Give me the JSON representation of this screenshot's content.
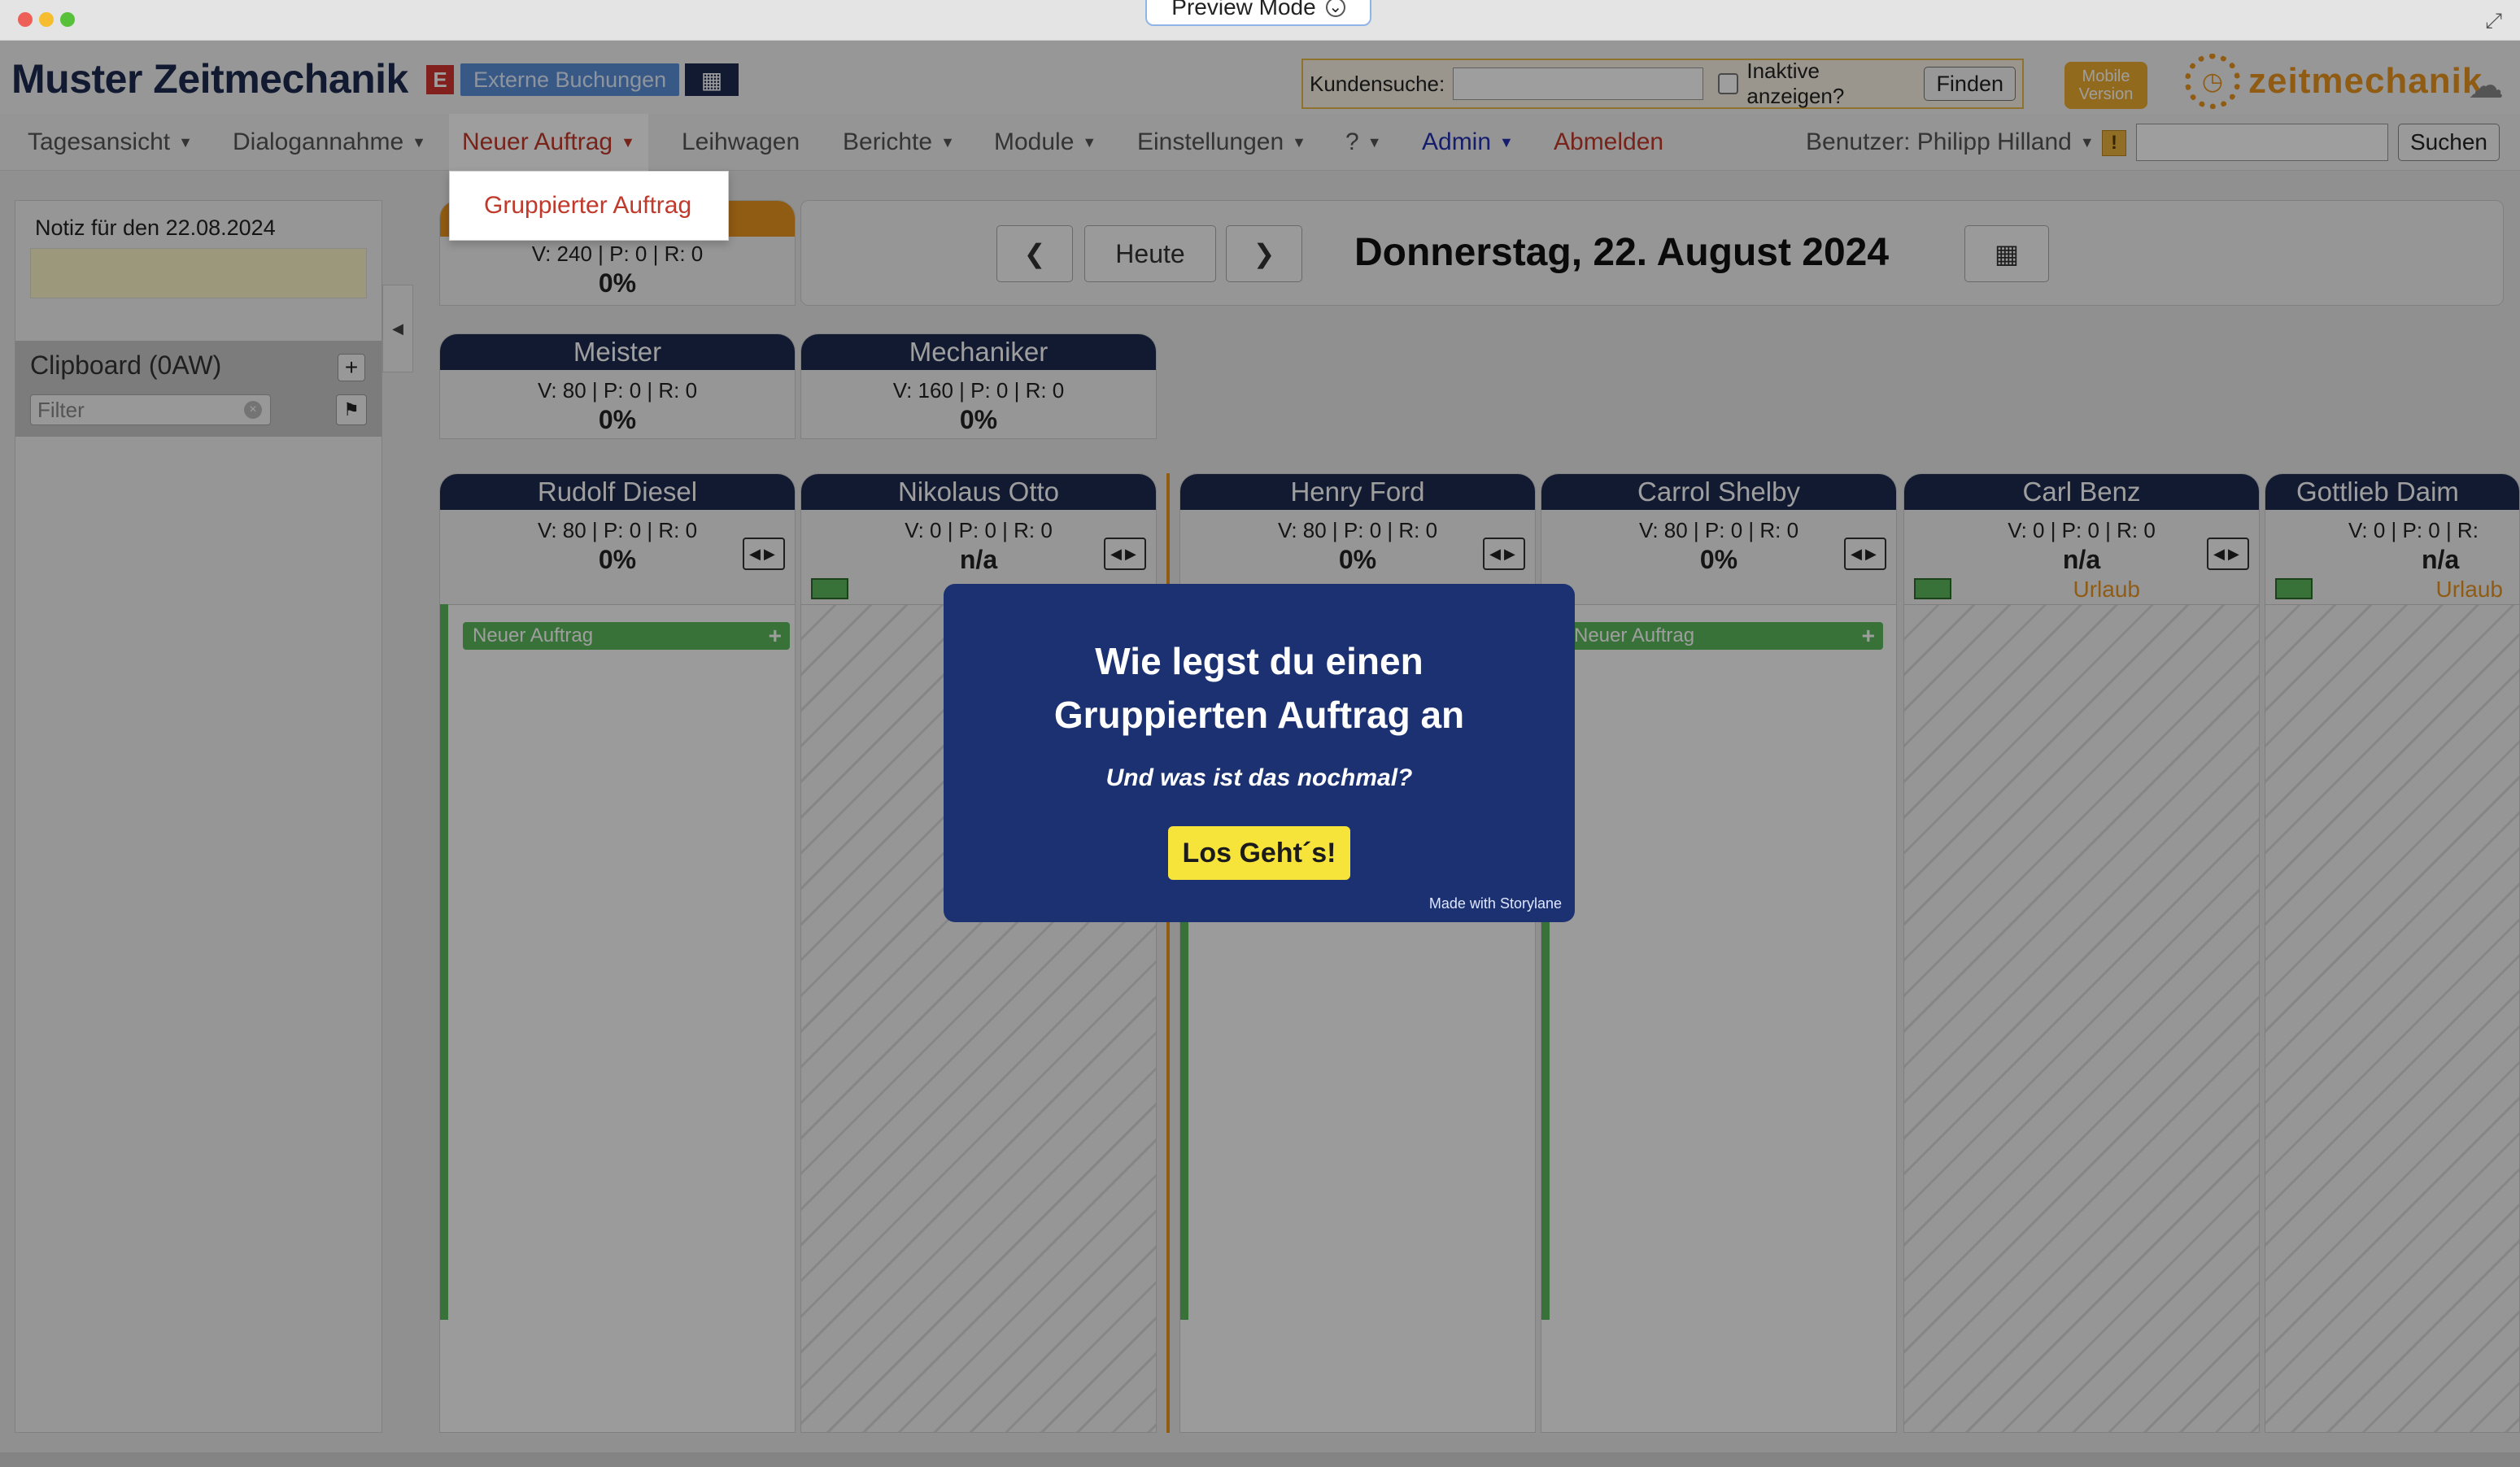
{
  "window": {
    "preview_mode": "Preview Mode"
  },
  "header": {
    "brand": "Muster Zeitmechanik",
    "badge": "E",
    "external_bookings": "Externe Buchungen",
    "customer_search_label": "Kundensuche:",
    "customer_search_value": "",
    "show_inactive_label": "Inaktive anzeigen?",
    "find_button": "Finden",
    "mobile_line1": "Mobile",
    "mobile_line2": "Version",
    "logo_text": "zeitmechanik"
  },
  "menu": {
    "items": [
      {
        "label": "Tagesansicht",
        "dropdown": true
      },
      {
        "label": "Dialogannahme",
        "dropdown": true
      },
      {
        "label": "Neuer Auftrag",
        "dropdown": true
      },
      {
        "label": "Leihwagen",
        "dropdown": false
      },
      {
        "label": "Berichte",
        "dropdown": true
      },
      {
        "label": "Module",
        "dropdown": true
      },
      {
        "label": "Einstellungen",
        "dropdown": true
      },
      {
        "label": "?",
        "dropdown": true
      },
      {
        "label": "Admin",
        "dropdown": true
      },
      {
        "label": "Abmelden",
        "dropdown": false
      }
    ],
    "user_label": "Benutzer: Philipp Hilland",
    "warning": "!",
    "search_value": "",
    "search_button": "Suchen",
    "dropdown_item": "Gruppierter Auftrag"
  },
  "sidebar": {
    "note_label": "Notiz für den 22.08.2024",
    "note_value": "",
    "clipboard_title": "Clipboard (0AW)",
    "filter_placeholder": "Filter"
  },
  "summary_cards": [
    {
      "title": "",
      "stats": "V: 240 | P: 0 | R: 0",
      "pct": "0%",
      "color": "#e8941e"
    },
    {
      "title": "Meister",
      "stats": "V: 80 | P: 0 | R: 0",
      "pct": "0%",
      "color": "#1e2b4f"
    },
    {
      "title": "Mechaniker",
      "stats": "V: 160 | P: 0 | R: 0",
      "pct": "0%",
      "color": "#1e2b4f"
    }
  ],
  "date_nav": {
    "today_button": "Heute",
    "date_title": "Donnerstag, 22. August 2024"
  },
  "employees": [
    {
      "name": "Rudolf Diesel",
      "stats": "V: 80 | P: 0 | R: 0",
      "pct": "0%",
      "status": "",
      "new_order": "Neuer Auftrag"
    },
    {
      "name": "Nikolaus Otto",
      "stats": "V: 0 | P: 0 | R: 0",
      "pct": "n/a",
      "status": "",
      "new_order": ""
    },
    {
      "name": "Henry Ford",
      "stats": "V: 80 | P: 0 | R: 0",
      "pct": "0%",
      "status": "",
      "new_order": ""
    },
    {
      "name": "Carrol Shelby",
      "stats": "V: 80 | P: 0 | R: 0",
      "pct": "0%",
      "status": "",
      "new_order": "Neuer Auftrag"
    },
    {
      "name": "Carl Benz",
      "stats": "V: 0 | P: 0 | R: 0",
      "pct": "n/a",
      "status": "Urlaub",
      "new_order": ""
    },
    {
      "name": "Gottlieb Daim",
      "stats": "V: 0 | P: 0 | R:",
      "pct": "n/a",
      "status": "Urlaub",
      "new_order": ""
    }
  ],
  "modal": {
    "title_line1": "Wie legst du einen",
    "title_line2": "Gruppierten Auftrag an",
    "subtitle": "Und was ist das nochmal?",
    "cta": "Los Geht´s!",
    "footer": "Made with Storylane"
  },
  "colors": {
    "navy": "#1e2b4f",
    "orange": "#e8941e",
    "green": "#5cb85c",
    "modal_bg": "#1b3172",
    "cta": "#f7e43b",
    "active_red": "#c0392b"
  }
}
